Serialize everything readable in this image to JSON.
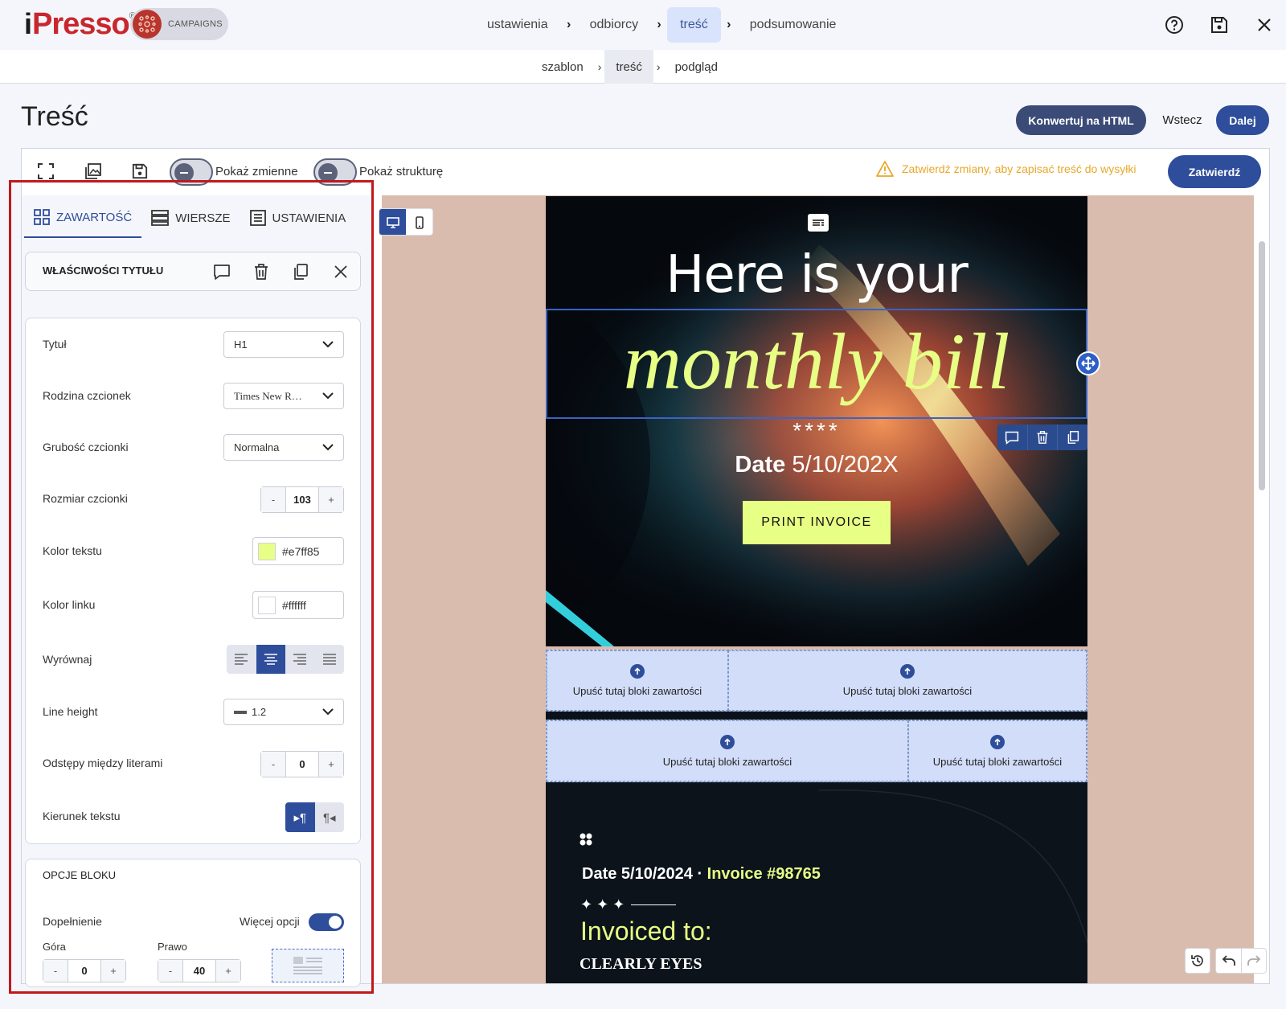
{
  "app": {
    "logo_i": "i",
    "logo_rest": "Presso",
    "logo_reg": "®",
    "badge": "CAMPAIGNS"
  },
  "steps": [
    {
      "label": "ustawienia",
      "active": false
    },
    {
      "label": "odbiorcy",
      "active": false
    },
    {
      "label": "treść",
      "active": true
    },
    {
      "label": "podsumowanie",
      "active": false
    }
  ],
  "substeps": [
    {
      "label": "szablon",
      "active": false
    },
    {
      "label": "treść",
      "active": true
    },
    {
      "label": "podgląd",
      "active": false
    }
  ],
  "page": {
    "title": "Treść",
    "convert_label": "Konwertuj na HTML",
    "back_label": "Wstecz",
    "next_label": "Dalej"
  },
  "toolbar": {
    "toggle_variables": "Pokaż zmienne",
    "toggle_structure": "Pokaż strukturę",
    "warning": "Zatwierdź zmiany, aby zapisać treść do wysyłki",
    "confirm_label": "Zatwierdź"
  },
  "panel": {
    "tabs": [
      "ZAWARTOŚĆ",
      "WIERSZE",
      "USTAWIENIA"
    ],
    "props_title": "WŁAŚCIWOŚCI TYTUŁU",
    "rows": {
      "title_label": "Tytuł",
      "title_value": "H1",
      "font_family_label": "Rodzina czcionek",
      "font_family_value": "Times New R…",
      "font_weight_label": "Grubość czcionki",
      "font_weight_value": "Normalna",
      "font_size_label": "Rozmiar czcionki",
      "font_size_value": "103",
      "text_color_label": "Kolor tekstu",
      "text_color_value": "#e7ff85",
      "link_color_label": "Kolor linku",
      "link_color_value": "#ffffff",
      "align_label": "Wyrównaj",
      "line_height_label": "Line height",
      "line_height_value": "1.2",
      "letter_spacing_label": "Odstępy między literami",
      "letter_spacing_value": "0",
      "direction_label": "Kierunek tekstu"
    },
    "stepper_minus": "-",
    "stepper_plus": "+",
    "block": {
      "title": "OPCJE BLOKU",
      "padding_label": "Dopełnienie",
      "more_options_label": "Więcej opcji",
      "top_label": "Góra",
      "top_value": "0",
      "right_label": "Prawo",
      "right_value": "40"
    }
  },
  "email": {
    "line1": "Here is your",
    "line2": "monthly bill",
    "stars": "****",
    "date_bold": "Date",
    "date_value": " 5/10/202X",
    "print_label": "PRINT INVOICE",
    "drop_label": "Upuść tutaj bloki zawartości",
    "inv_date": "Date 5/10/2024 · ",
    "inv_number": "Invoice #98765",
    "inv_stars": "✦ ✦ ✦",
    "invoiced_to": "Invoiced to:",
    "company": "CLEARLY EYES"
  },
  "colors": {
    "accent": "#2e4d9b",
    "highlight": "#e7ff85",
    "canvas_bg": "#d9bcae",
    "frame_red": "#c0191d"
  }
}
